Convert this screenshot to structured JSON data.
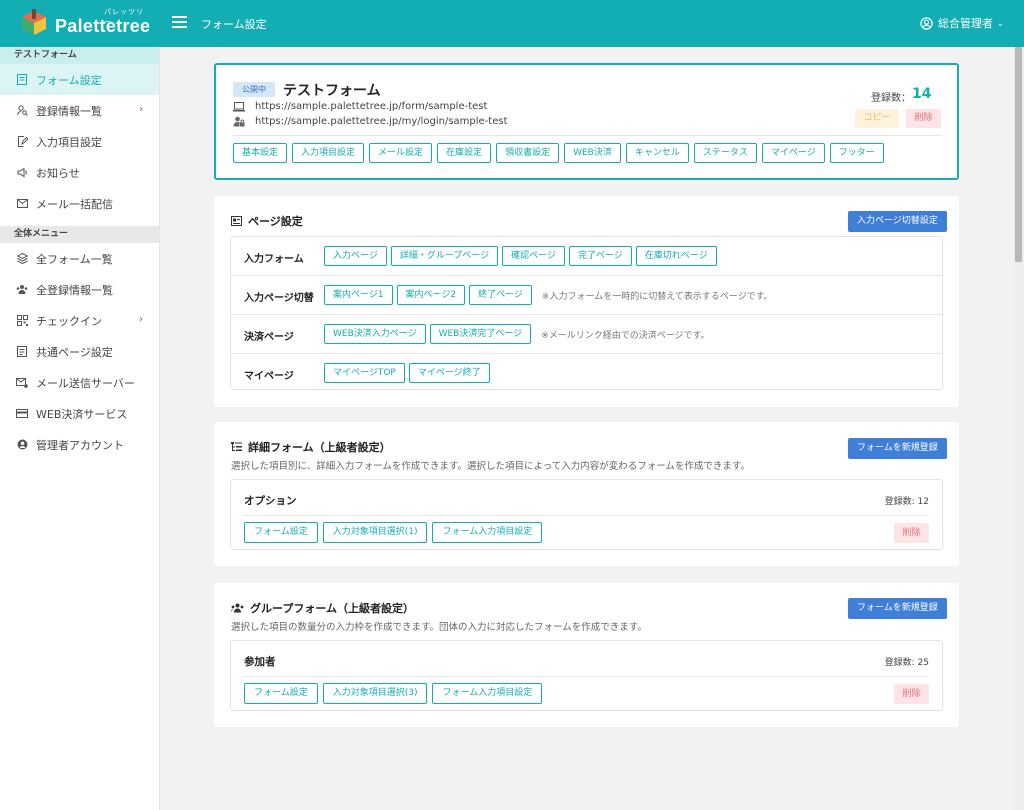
{
  "app": {
    "logo_text": "Palettetree",
    "logo_ruby": "パレッツリー",
    "page_title": "フォーム設定",
    "user_name": "総合管理者"
  },
  "colors": {
    "primary": "#13adb4",
    "button_blue": "#3f7fd7",
    "danger": "#e8707a",
    "warning": "#f2b96a"
  },
  "sidebar": {
    "section1_title": "テストフォーム",
    "section1_items": [
      {
        "label": "フォーム設定",
        "icon": "form-icon",
        "active": true
      },
      {
        "label": "登録情報一覧",
        "icon": "user-search-icon",
        "has_arrow": true
      },
      {
        "label": "入力項目設定",
        "icon": "edit-doc-icon"
      },
      {
        "label": "お知らせ",
        "icon": "megaphone-icon"
      },
      {
        "label": "メール一括配信",
        "icon": "mail-icon"
      }
    ],
    "section2_title": "全体メニュー",
    "section2_items": [
      {
        "label": "全フォーム一覧",
        "icon": "layers-icon"
      },
      {
        "label": "全登録情報一覧",
        "icon": "users-icon"
      },
      {
        "label": "チェックイン",
        "icon": "qr-icon",
        "has_arrow": true
      },
      {
        "label": "共通ページ設定",
        "icon": "page-icon"
      },
      {
        "label": "メール送信サーバー",
        "icon": "mail-server-icon"
      },
      {
        "label": "WEB決済サービス",
        "icon": "card-icon"
      },
      {
        "label": "管理者アカウント",
        "icon": "account-icon"
      }
    ]
  },
  "form_card": {
    "status": "公開中",
    "title": "テストフォーム",
    "url_public": "https://sample.palettetree.jp/form/sample-test",
    "url_mypage": "https://sample.palettetree.jp/my/login/sample-test",
    "count_label": "登録数：",
    "count_value": "14",
    "copy_label": "コピー",
    "delete_label": "削除",
    "tabs": [
      "基本設定",
      "入力項目設定",
      "メール設定",
      "在庫設定",
      "領収書設定",
      "WEB決済",
      "キャンセル",
      "ステータス",
      "マイページ",
      "フッター"
    ]
  },
  "page_settings": {
    "title": "ページ設定",
    "switch_button": "入力ページ切替設定",
    "rows": [
      {
        "label": "入力フォーム",
        "buttons": [
          "入力ページ",
          "詳細・グループページ",
          "確認ページ",
          "完了ページ",
          "在庫切れページ"
        ],
        "note": ""
      },
      {
        "label": "入力ページ切替",
        "buttons": [
          "案内ページ1",
          "案内ページ2",
          "終了ページ"
        ],
        "note": "※入力フォームを一時的に切替えて表示するページです。"
      },
      {
        "label": "決済ページ",
        "buttons": [
          "WEB決済入力ページ",
          "WEB決済完了ページ"
        ],
        "note": "※メールリンク経由での決済ページです。"
      },
      {
        "label": "マイページ",
        "buttons": [
          "マイページTOP",
          "マイページ終了"
        ],
        "note": ""
      }
    ]
  },
  "detail_form": {
    "title": "詳細フォーム（上級者設定）",
    "description": "選択した項目別に、詳細入力フォームを作成できます。選択した項目によって入力内容が変わるフォームを作成できます。",
    "new_button": "フォームを新規登録",
    "item": {
      "name": "オプション",
      "count": "登録数: 12",
      "buttons": [
        "フォーム設定",
        "入力対象項目選択(1)",
        "フォーム入力項目設定"
      ],
      "delete_label": "削除"
    }
  },
  "group_form": {
    "title": "グループフォーム（上級者設定）",
    "description": "選択した項目の数量分の入力枠を作成できます。団体の入力に対応したフォームを作成できます。",
    "new_button": "フォームを新規登録",
    "item": {
      "name": "参加者",
      "count": "登録数: 25",
      "buttons": [
        "フォーム設定",
        "入力対象項目選択(3)",
        "フォーム入力項目設定"
      ],
      "delete_label": "削除"
    }
  }
}
